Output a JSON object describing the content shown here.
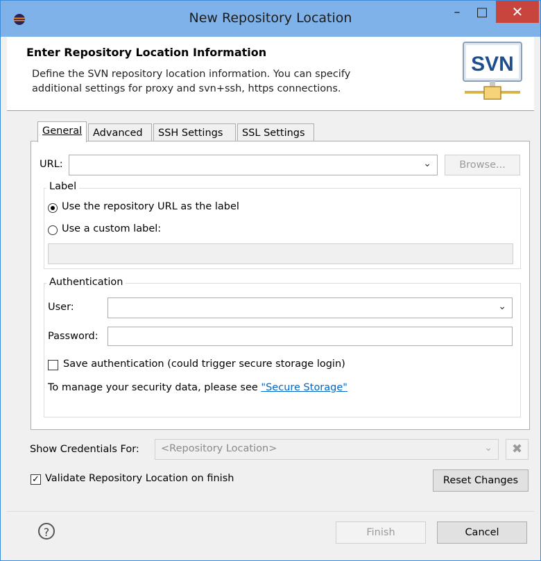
{
  "window": {
    "title": "New Repository Location",
    "min_glyph": "–",
    "max_glyph": "□",
    "close_glyph": "✕"
  },
  "header": {
    "title": "Enter Repository Location Information",
    "desc_line1": "Define the SVN repository location information. You can specify",
    "desc_line2": "additional settings for proxy and svn+ssh, https connections.",
    "logo_text": "SVN"
  },
  "tabs": [
    {
      "label": "General",
      "active": true
    },
    {
      "label": "Advanced",
      "active": false
    },
    {
      "label": "SSH Settings",
      "active": false
    },
    {
      "label": "SSL Settings",
      "active": false
    }
  ],
  "url": {
    "label": "URL:",
    "value": "",
    "browse": "Browse..."
  },
  "label_group": {
    "title": "Label",
    "option1": "Use the repository URL as the label",
    "option2": "Use a custom label:",
    "custom_value": ""
  },
  "auth_group": {
    "title": "Authentication",
    "user_label": "User:",
    "user_value": "",
    "password_label": "Password:",
    "password_value": "",
    "save_auth": "Save authentication (could trigger secure storage login)",
    "manage_text": "To manage your security data, please see ",
    "manage_link": "\"Secure Storage\""
  },
  "credentials": {
    "label": "Show Credentials For:",
    "value": "<Repository Location>"
  },
  "validate": {
    "label": "Validate Repository Location on finish",
    "checked": true
  },
  "buttons": {
    "reset": "Reset Changes",
    "finish": "Finish",
    "cancel": "Cancel",
    "help": "?"
  }
}
